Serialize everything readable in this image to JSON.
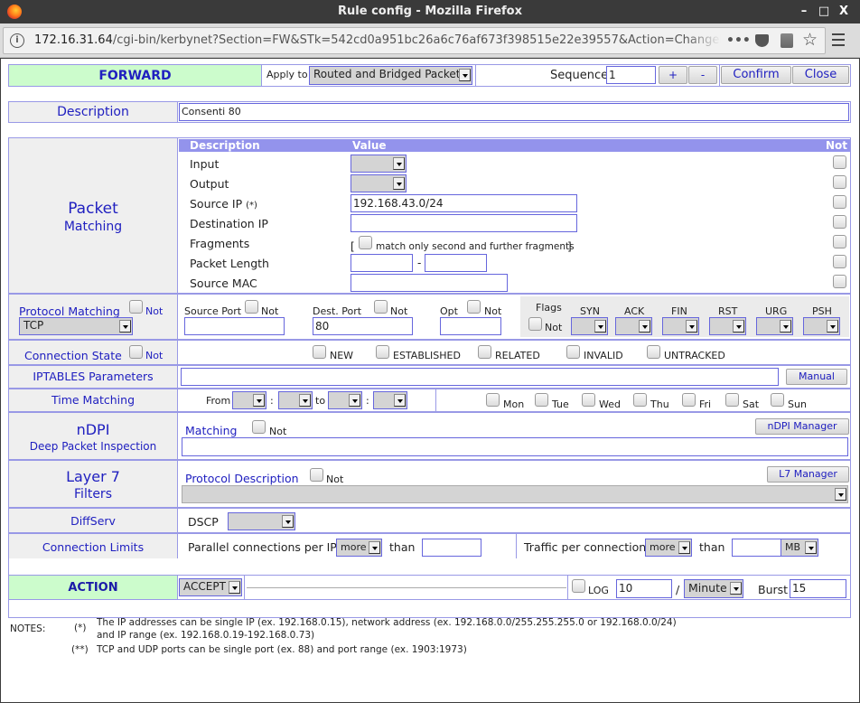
{
  "window": {
    "title": "Rule config - Mozilla Firefox",
    "controls": {
      "minimize": "–",
      "maximize": "□",
      "close": "X"
    }
  },
  "browser": {
    "url_host": "172.16.31.64",
    "url_path": "/cgi-bin/kerbynet?Section=FW&STk=542cd0a951bc26a6c76af673f398515e22e39557&Action=ChangeRule&Chain=FORWARD",
    "icons": [
      "info-icon",
      "more-icon",
      "pocket-icon",
      "downloads-icon",
      "bookmark-star-icon",
      "menu-icon"
    ]
  },
  "header": {
    "chain": "FORWARD",
    "apply_to_label": "Apply to",
    "apply_to_value": "Routed and Bridged Packets",
    "sequence_label": "Sequence",
    "sequence_value": "1",
    "plus": "+",
    "minus": "-",
    "confirm": "Confirm",
    "close": "Close"
  },
  "description": {
    "label": "Description",
    "value": "Consenti 80"
  },
  "packet_matching": {
    "title1": "Packet",
    "title2": "Matching",
    "col_description": "Description",
    "col_value": "Value",
    "col_not": "Not",
    "rows": {
      "input": {
        "label": "Input",
        "value": ""
      },
      "output": {
        "label": "Output",
        "value": ""
      },
      "source_ip": {
        "label": "Source IP",
        "note": "(*)",
        "value": "192.168.43.0/24"
      },
      "destination_ip": {
        "label": "Destination IP",
        "value": ""
      },
      "fragments": {
        "label": "Fragments",
        "open": "[",
        "option": "match only second and further fragments",
        "close": "]"
      },
      "packet_length": {
        "label": "Packet Length",
        "from": "",
        "dash": "-",
        "to": ""
      },
      "source_mac": {
        "label": "Source MAC",
        "value": ""
      }
    }
  },
  "protocol": {
    "label": "Protocol Matching",
    "not": "Not",
    "value": "TCP",
    "source_port_label": "Source Port",
    "source_port_value": "",
    "dest_port_label": "Dest. Port",
    "dest_port_value": "80",
    "opt_label": "Opt",
    "opt_value": "",
    "flags_label": "Flags",
    "flags": [
      "SYN",
      "ACK",
      "FIN",
      "RST",
      "URG",
      "PSH"
    ]
  },
  "connection_state": {
    "label": "Connection State",
    "not": "Not",
    "states": [
      "NEW",
      "ESTABLISHED",
      "RELATED",
      "INVALID",
      "UNTRACKED"
    ]
  },
  "iptables": {
    "label": "IPTABLES Parameters",
    "value": "",
    "manual": "Manual"
  },
  "time": {
    "label": "Time Matching",
    "from": "From",
    "colon": ":",
    "to": "to",
    "days": [
      "Mon",
      "Tue",
      "Wed",
      "Thu",
      "Fri",
      "Sat",
      "Sun"
    ]
  },
  "ndpi": {
    "title": "nDPI",
    "subtitle": "Deep Packet Inspection",
    "matching": "Matching",
    "not": "Not",
    "value": "",
    "manager": "nDPI Manager"
  },
  "layer7": {
    "title": "Layer 7",
    "subtitle": "Filters",
    "protocol_description": "Protocol Description",
    "not": "Not",
    "value": "",
    "manager": "L7 Manager"
  },
  "diffserv": {
    "label": "DiffServ",
    "dscp": "DSCP",
    "value": ""
  },
  "connection_limits": {
    "label": "Connection Limits",
    "parallel_label": "Parallel connections per IP",
    "parallel_cmp": "more",
    "than": "than",
    "parallel_value": "",
    "traffic_label": "Traffic per connection",
    "traffic_cmp": "more",
    "traffic_value": "",
    "traffic_unit": "MB"
  },
  "action": {
    "label": "ACTION",
    "value": "ACCEPT",
    "log": "LOG",
    "log_rate": "10",
    "slash": "/",
    "period": "Minute",
    "burst_label": "Burst",
    "burst_value": "15"
  },
  "notes": {
    "label": "NOTES:",
    "n1_mark": "(*)",
    "n1_line1": "The IP addresses can be single IP (ex. 192.168.0.15), network address (ex. 192.168.0.0/255.255.255.0 or 192.168.0.0/24)",
    "n1_line2": "and IP range (ex. 192.168.0.19-192.168.0.73)",
    "n2_mark": "(**)",
    "n2_line": "TCP and UDP ports can be single port (ex. 88) and port range (ex. 1903:1973)"
  }
}
